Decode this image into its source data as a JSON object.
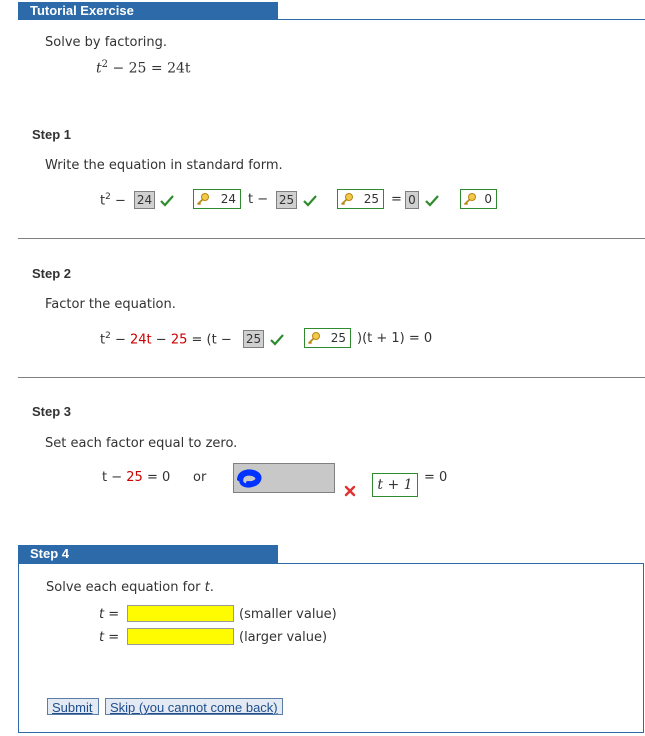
{
  "header": {
    "title": "Tutorial Exercise"
  },
  "problem": {
    "instruction": "Solve by factoring.",
    "eq_lhs_base": "t",
    "eq_lhs_exp": "2",
    "eq_rest": " − 25 = 24t"
  },
  "step1": {
    "label": "Step 1",
    "instruction": "Write the equation in standard form.",
    "t_base": "t",
    "t_exp": "2",
    "minus1": " −",
    "box1": "24",
    "key1": "24",
    "t_minus": "t −",
    "box2": "25",
    "key2": "25",
    "equals": "=",
    "box3": "0",
    "key3": "0"
  },
  "step2": {
    "label": "Step 2",
    "instruction": "Factor the equation.",
    "t_base": "t",
    "t_exp": "2",
    "minus": " −",
    "red1": "24t",
    "minus2": "−",
    "red2": "25",
    "open": "= (t −",
    "box": "25",
    "key": "25",
    "close": ")(t + 1) = 0"
  },
  "step3": {
    "label": "Step 3",
    "instruction": "Set each factor equal to zero.",
    "left_t": "t −",
    "left_red": "25",
    "left_tail": "= 0",
    "or": "or",
    "answer_box": "t + 1",
    "eq_zero": "= 0"
  },
  "step4": {
    "label": "Step 4",
    "instruction_pre": "Solve each equation for ",
    "instruction_var": "t",
    "instruction_post": ".",
    "row1_label": "t =",
    "row1_note": "(smaller value)",
    "row2_label": "t =",
    "row2_note": "(larger value)",
    "submit": "Submit",
    "skip": "Skip (you cannot come back)"
  },
  "colors": {
    "accent": "#2c6aa9",
    "correct": "#2e8b2e",
    "wrong": "#e03030",
    "highlight": "#fffb00",
    "scribble": "#0033ff"
  }
}
